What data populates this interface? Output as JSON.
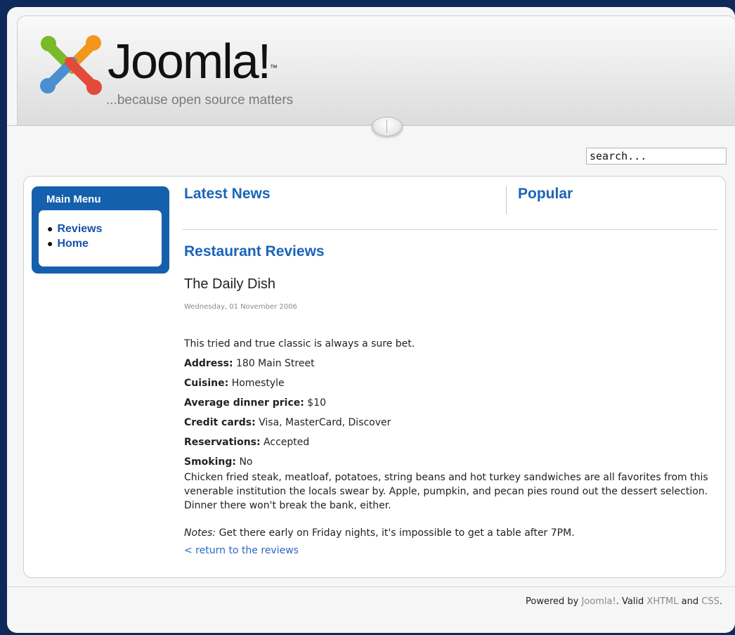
{
  "header": {
    "logo_text": "Joomla!",
    "trademark": "™",
    "tagline": "...because open source matters"
  },
  "search": {
    "value": "search..."
  },
  "main_menu": {
    "title": "Main Menu",
    "items": [
      {
        "label": "Reviews"
      },
      {
        "label": "Home"
      }
    ]
  },
  "columns": {
    "latest_news": "Latest News",
    "popular": "Popular"
  },
  "article": {
    "section_title": "Restaurant Reviews",
    "title": "The Daily Dish",
    "date": "Wednesday, 01 November 2006",
    "intro": "This tried and true classic is always a sure bet.",
    "fields": [
      {
        "label": "Address:",
        "value": "180 Main Street"
      },
      {
        "label": "Cuisine:",
        "value": "Homestyle"
      },
      {
        "label": "Average dinner price:",
        "value": "$10"
      },
      {
        "label": "Credit cards:",
        "value": "Visa, MasterCard, Discover"
      },
      {
        "label": "Reservations:",
        "value": "Accepted"
      },
      {
        "label": "Smoking:",
        "value": "No"
      }
    ],
    "description": "Chicken fried steak, meatloaf, potatoes, string beans and hot turkey sandwiches are all favorites from this venerable institution the locals swear by. Apple, pumpkin, and pecan pies round out the dessert selection. Dinner there won't break the bank, either.",
    "notes_label": "Notes:",
    "notes_text": "Get there early on Friday nights, it's impossible to get a table after 7PM.",
    "return_link": "< return to the reviews"
  },
  "footer": {
    "powered_by": "Powered by",
    "joomla_link": "Joomla!",
    "valid_text": ". Valid",
    "xhtml_link": "XHTML",
    "and_text": "and",
    "css_link": "CSS",
    "end": "."
  },
  "colors": {
    "frame": "#0d2a5a",
    "menu_blue": "#1560ad",
    "heading_blue": "#1a64b7",
    "link_blue": "#2a69c5"
  }
}
